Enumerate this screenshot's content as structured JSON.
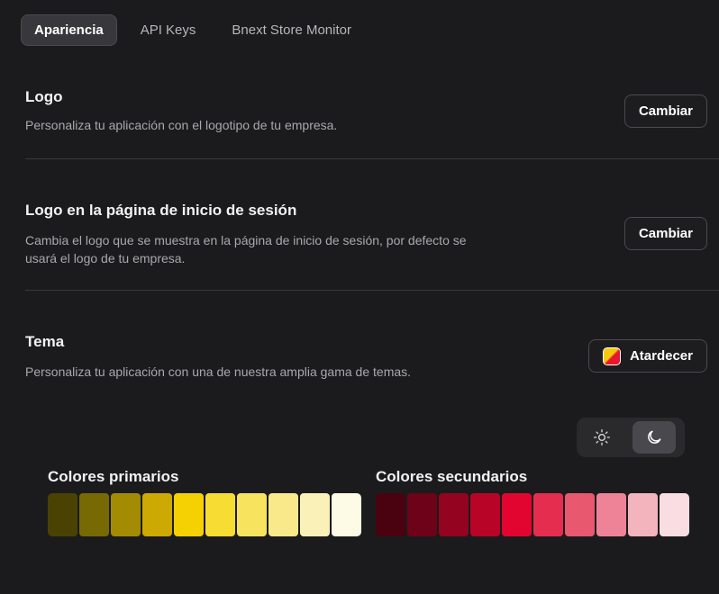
{
  "tabs": [
    {
      "label": "Apariencia"
    },
    {
      "label": "API Keys"
    },
    {
      "label": "Bnext Store Monitor"
    }
  ],
  "logo": {
    "title": "Logo",
    "description": "Personaliza tu aplicación con el logotipo de tu empresa.",
    "button": "Cambiar"
  },
  "login_logo": {
    "title": "Logo en la página de inicio de sesión",
    "description": "Cambia el logo que se muestra en la página de inicio de sesión, por defecto se usará el logo de tu empresa.",
    "button": "Cambiar"
  },
  "theme": {
    "title": "Tema",
    "description": "Personaliza tu aplicación con una de nuestra amplia gama de temas.",
    "selected": "Atardecer",
    "swatch_colors": [
      "#f6c90e",
      "#e8162f"
    ],
    "mode_options": [
      {
        "icon": "sun-icon",
        "active": false
      },
      {
        "icon": "moon-icon",
        "active": true
      }
    ]
  },
  "palettes": {
    "primary": {
      "title": "Colores primarios",
      "colors": [
        "#4a4202",
        "#776904",
        "#a38c03",
        "#cda903",
        "#f5d103",
        "#f7dc33",
        "#f8e35f",
        "#f9e98a",
        "#faf1b8",
        "#fdfae6"
      ]
    },
    "secondary": {
      "title": "Colores secundarios",
      "colors": [
        "#4a0110",
        "#6d0218",
        "#94031f",
        "#b80426",
        "#e2052f",
        "#e52e4f",
        "#e8586f",
        "#ee8398",
        "#f3b4bd",
        "#fadde3"
      ]
    }
  }
}
